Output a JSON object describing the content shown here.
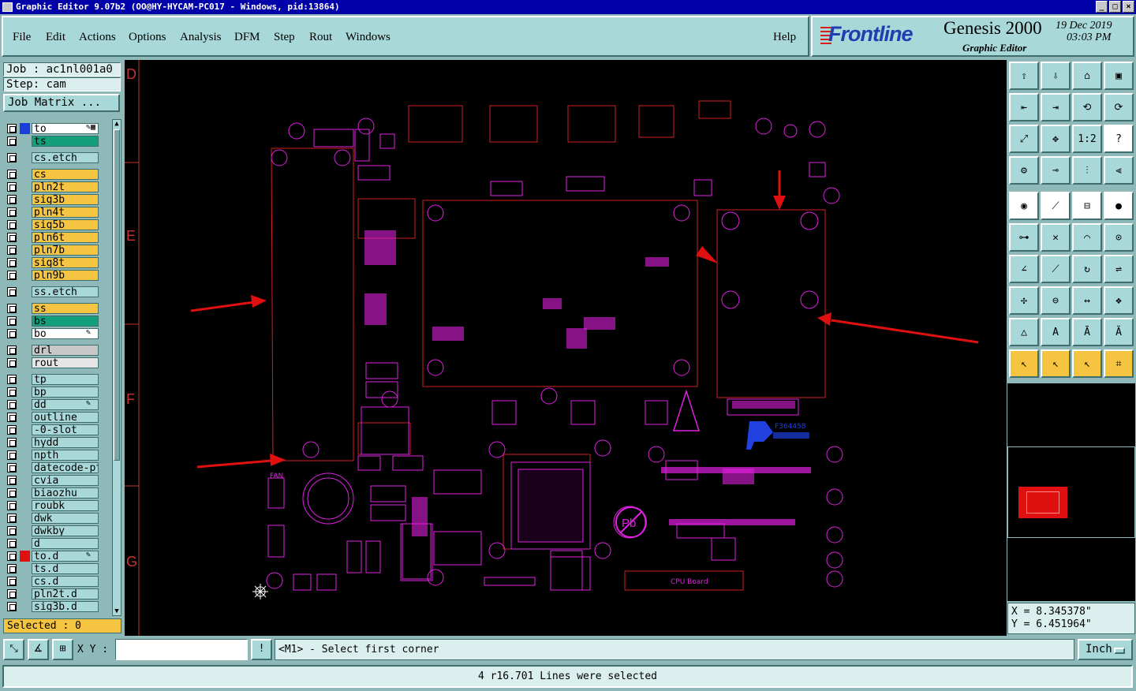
{
  "window": {
    "title": "Graphic Editor 9.07b2  (OO@HY-HYCAM-PC017 - Windows, pid:13864)",
    "controls": [
      "_",
      "□",
      "×"
    ]
  },
  "menu": [
    "File",
    "Edit",
    "Actions",
    "Options",
    "Analysis",
    "DFM",
    "Step",
    "Rout",
    "Windows"
  ],
  "help_label": "Help",
  "brand": {
    "logo": "Frontline",
    "product": "Genesis 2000",
    "subtitle": "Graphic Editor",
    "date": "19 Dec 2019",
    "time": "03:03 PM"
  },
  "job": {
    "job_line": "Job : ac1nl001a0",
    "step_line": "Step: cam",
    "matrix_button": "Job Matrix ..."
  },
  "layers": [
    {
      "name": "to",
      "color": "#ffffff",
      "sq": "#1a3fd8",
      "tag": "✎▦"
    },
    {
      "name": "ts",
      "color": "#12a07a",
      "sq": "",
      "tag": ""
    },
    {
      "name": "cs.etch",
      "color": "#a9d8d8",
      "sq": "",
      "tag": ""
    },
    {
      "name": "cs",
      "color": "#f5c542",
      "sq": "",
      "tag": ""
    },
    {
      "name": "pln2t",
      "color": "#f5c542",
      "sq": "",
      "tag": ""
    },
    {
      "name": "sig3b",
      "color": "#f5c542",
      "sq": "",
      "tag": ""
    },
    {
      "name": "pln4t",
      "color": "#f5c542",
      "sq": "",
      "tag": ""
    },
    {
      "name": "sig5b",
      "color": "#f5c542",
      "sq": "",
      "tag": ""
    },
    {
      "name": "pln6t",
      "color": "#f5c542",
      "sq": "",
      "tag": ""
    },
    {
      "name": "pln7b",
      "color": "#f5c542",
      "sq": "",
      "tag": ""
    },
    {
      "name": "sig8t",
      "color": "#f5c542",
      "sq": "",
      "tag": ""
    },
    {
      "name": "pln9b",
      "color": "#f5c542",
      "sq": "",
      "tag": ""
    },
    {
      "name": "ss.etch",
      "color": "#a9d8d8",
      "sq": "",
      "tag": ""
    },
    {
      "name": "ss",
      "color": "#f5c542",
      "sq": "",
      "tag": ""
    },
    {
      "name": "bs",
      "color": "#12a07a",
      "sq": "",
      "tag": ""
    },
    {
      "name": "bo",
      "color": "#ffffff",
      "sq": "",
      "tag": "✎"
    },
    {
      "name": "drl",
      "color": "#c8c8c8",
      "sq": "",
      "tag": ""
    },
    {
      "name": "rout",
      "color": "#e6e6e6",
      "sq": "",
      "tag": ""
    },
    {
      "name": "tp",
      "color": "#a9d8d8",
      "sq": "",
      "tag": ""
    },
    {
      "name": "bp",
      "color": "#a9d8d8",
      "sq": "",
      "tag": ""
    },
    {
      "name": "dd",
      "color": "#a9d8d8",
      "sq": "",
      "tag": "✎"
    },
    {
      "name": "outline",
      "color": "#a9d8d8",
      "sq": "",
      "tag": ""
    },
    {
      "name": "-0-slot",
      "color": "#a9d8d8",
      "sq": "",
      "tag": ""
    },
    {
      "name": "hydd",
      "color": "#a9d8d8",
      "sq": "",
      "tag": ""
    },
    {
      "name": "npth",
      "color": "#a9d8d8",
      "sq": "",
      "tag": ""
    },
    {
      "name": "datecode-pto",
      "color": "#a9d8d8",
      "sq": "",
      "tag": ""
    },
    {
      "name": "cvia",
      "color": "#a9d8d8",
      "sq": "",
      "tag": ""
    },
    {
      "name": "biaozhu",
      "color": "#a9d8d8",
      "sq": "",
      "tag": ""
    },
    {
      "name": "roubk",
      "color": "#a9d8d8",
      "sq": "",
      "tag": ""
    },
    {
      "name": "dwk",
      "color": "#a9d8d8",
      "sq": "",
      "tag": ""
    },
    {
      "name": "dwkby",
      "color": "#a9d8d8",
      "sq": "",
      "tag": ""
    },
    {
      "name": "d",
      "color": "#a9d8d8",
      "sq": "",
      "tag": ""
    },
    {
      "name": "to.d",
      "color": "#a9d8d8",
      "sq": "#e01010",
      "tag": "✎"
    },
    {
      "name": "ts.d",
      "color": "#a9d8d8",
      "sq": "",
      "tag": ""
    },
    {
      "name": "cs.d",
      "color": "#a9d8d8",
      "sq": "",
      "tag": ""
    },
    {
      "name": "pln2t.d",
      "color": "#a9d8d8",
      "sq": "",
      "tag": ""
    },
    {
      "name": "sig3b.d",
      "color": "#a9d8d8",
      "sq": "",
      "tag": ""
    }
  ],
  "selected_count": "Selected : 0",
  "ruler_labels": [
    "D",
    "E",
    "F",
    "G"
  ],
  "pcb": {
    "board_label": "CPU Board",
    "fan_label": "FAN",
    "pb_label": "Pb",
    "mark_code": "F364458",
    "accent_layer_color": "#e020e0",
    "outline_color": "#d02020"
  },
  "tools": [
    {
      "name": "open-icon",
      "glyph": "⇧",
      "state": ""
    },
    {
      "name": "save-icon",
      "glyph": "⇩",
      "state": ""
    },
    {
      "name": "home-icon",
      "glyph": "⌂",
      "state": ""
    },
    {
      "name": "window-icon",
      "glyph": "▣",
      "state": ""
    },
    {
      "name": "pan-left-icon",
      "glyph": "⇤",
      "state": ""
    },
    {
      "name": "pan-right-icon",
      "glyph": "⇥",
      "state": ""
    },
    {
      "name": "undo-icon",
      "glyph": "⟲",
      "state": ""
    },
    {
      "name": "redo-icon",
      "glyph": "⟳",
      "state": ""
    },
    {
      "name": "zoom-fit-icon",
      "glyph": "⤢",
      "state": ""
    },
    {
      "name": "zoom-center-icon",
      "glyph": "✥",
      "state": ""
    },
    {
      "name": "zoom-1-2-icon",
      "glyph": "1:2",
      "state": ""
    },
    {
      "name": "help-icon",
      "glyph": "?",
      "state": "white"
    },
    {
      "name": "settings-icon",
      "glyph": "⚙",
      "state": ""
    },
    {
      "name": "snap-icon",
      "glyph": "⊸",
      "state": ""
    },
    {
      "name": "layers-icon",
      "glyph": "⫶",
      "state": ""
    },
    {
      "name": "display-icon",
      "glyph": "⫷",
      "state": ""
    },
    {
      "name": "pad-icon",
      "glyph": "◉",
      "state": "white"
    },
    {
      "name": "line-icon",
      "glyph": "⟋",
      "state": "white"
    },
    {
      "name": "ruler-icon",
      "glyph": "⊟",
      "state": "white"
    },
    {
      "name": "circle-icon",
      "glyph": "●",
      "state": "white"
    },
    {
      "name": "connect-icon",
      "glyph": "⊶",
      "state": ""
    },
    {
      "name": "cross-icon",
      "glyph": "✕",
      "state": ""
    },
    {
      "name": "arc-icon",
      "glyph": "⌒",
      "state": ""
    },
    {
      "name": "node-icon",
      "glyph": "⊙",
      "state": ""
    },
    {
      "name": "angle-icon",
      "glyph": "∠",
      "state": ""
    },
    {
      "name": "slope-icon",
      "glyph": "⟋",
      "state": ""
    },
    {
      "name": "rotate-icon",
      "glyph": "↻",
      "state": ""
    },
    {
      "name": "mirror-icon",
      "glyph": "⇌",
      "state": ""
    },
    {
      "name": "move-icon",
      "glyph": "✣",
      "state": ""
    },
    {
      "name": "split-icon",
      "glyph": "⊖",
      "state": ""
    },
    {
      "name": "measure-icon",
      "glyph": "↔",
      "state": ""
    },
    {
      "name": "group-icon",
      "glyph": "❖",
      "state": ""
    },
    {
      "name": "triangle-icon",
      "glyph": "△",
      "state": ""
    },
    {
      "name": "a-icon",
      "glyph": "A",
      "state": ""
    },
    {
      "name": "a-frame-icon",
      "glyph": "Ā",
      "state": ""
    },
    {
      "name": "a-cross-icon",
      "glyph": "Ã",
      "state": ""
    },
    {
      "name": "pointer-icon",
      "glyph": "↖",
      "state": "active"
    },
    {
      "name": "pointer-box-icon",
      "glyph": "↖",
      "state": "active"
    },
    {
      "name": "pointer-select-icon",
      "glyph": "↖",
      "state": "active"
    },
    {
      "name": "net-select-icon",
      "glyph": "⌗",
      "state": "active"
    }
  ],
  "coords": {
    "x": "X = 8.345378\"",
    "y": "Y = 6.451964\""
  },
  "xy_label": "X Y :",
  "xy_value": "",
  "prompt": "<M1> - Select first corner",
  "unit": "Inch",
  "status": "4 r16.701 Lines were selected"
}
